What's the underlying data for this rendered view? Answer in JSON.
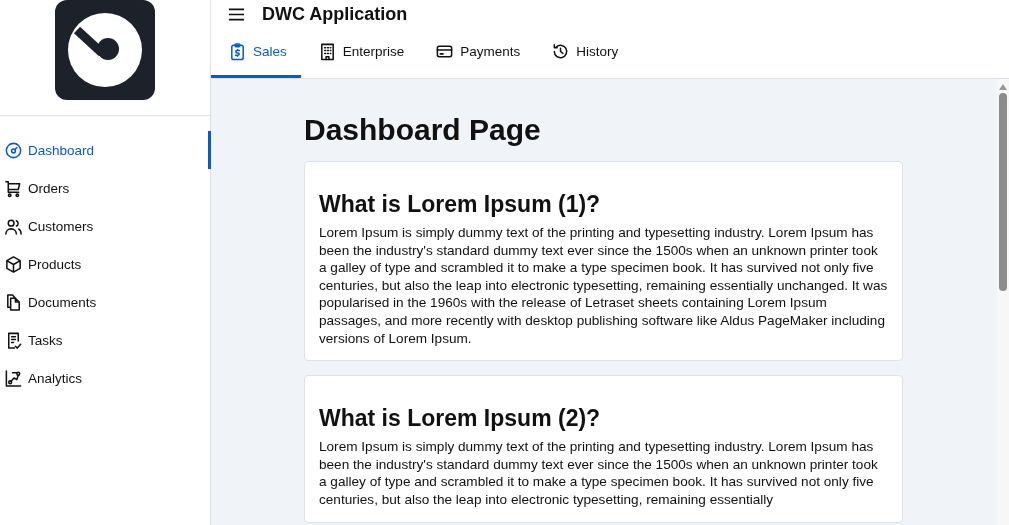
{
  "header": {
    "title": "DWC Application"
  },
  "tabs": [
    {
      "label": "Sales",
      "selected": true
    },
    {
      "label": "Enterprise",
      "selected": false
    },
    {
      "label": "Payments",
      "selected": false
    },
    {
      "label": "History",
      "selected": false
    }
  ],
  "sidebar": {
    "items": [
      {
        "label": "Dashboard",
        "selected": true
      },
      {
        "label": "Orders",
        "selected": false
      },
      {
        "label": "Customers",
        "selected": false
      },
      {
        "label": "Products",
        "selected": false
      },
      {
        "label": "Documents",
        "selected": false
      },
      {
        "label": "Tasks",
        "selected": false
      },
      {
        "label": "Analytics",
        "selected": false
      }
    ]
  },
  "page": {
    "title": "Dashboard Page",
    "cards": [
      {
        "heading": "What is Lorem Ipsum (1)?",
        "body": "Lorem Ipsum is simply dummy text of the printing and typesetting industry. Lorem Ipsum has been the industry's standard dummy text ever since the 1500s when an unknown printer took a galley of type and scrambled it to make a type specimen book. It has survived not only five centuries, but also the leap into electronic typesetting, remaining essentially unchanged. It was popularised in the 1960s with the release of Letraset sheets containing Lorem Ipsum passages, and more recently with desktop publishing software like Aldus PageMaker including versions of Lorem Ipsum."
      },
      {
        "heading": "What is Lorem Ipsum (2)?",
        "body": "Lorem Ipsum is simply dummy text of the printing and typesetting industry. Lorem Ipsum has been the industry's standard dummy text ever since the 1500s when an unknown printer took a galley of type and scrambled it to make a type specimen book. It has survived not only five centuries, but also the leap into electronic typesetting, remaining essentially"
      }
    ]
  }
}
